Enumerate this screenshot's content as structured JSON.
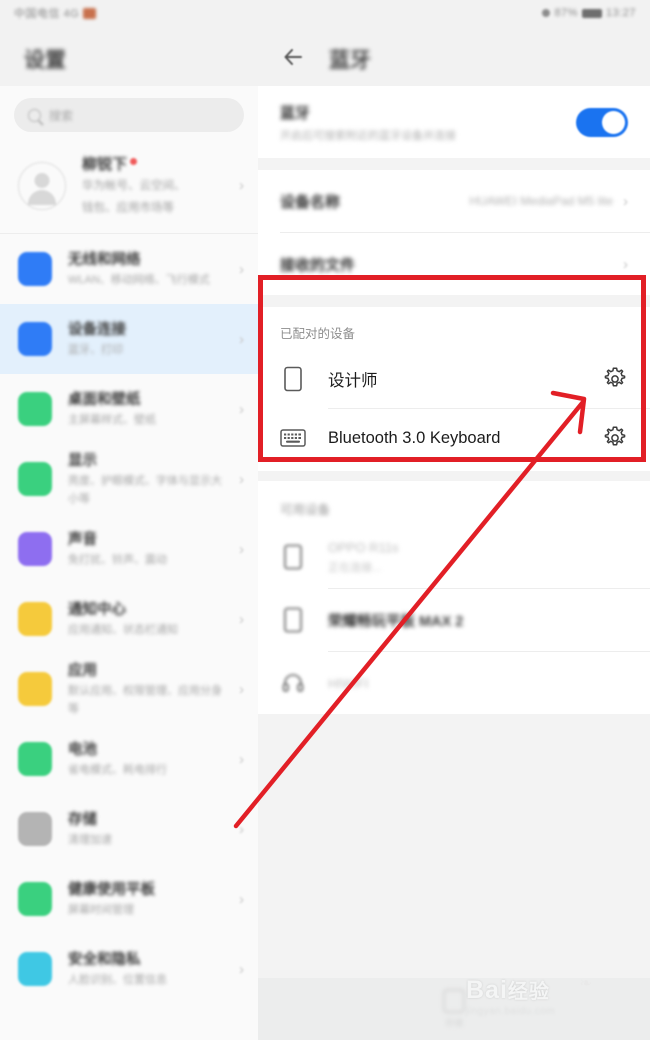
{
  "statusbar": {
    "left_text": "中国电信 4G",
    "right_text": "87%",
    "time": "13:27"
  },
  "sidebar": {
    "title": "设置",
    "search": {
      "placeholder": "搜索",
      "icon": "search-icon"
    },
    "account": {
      "name": "柳锐下",
      "badge": "•",
      "sub_line1": "华为帐号、云空间、",
      "sub_line2": "钱包、应用市场等",
      "chevron": "›"
    },
    "items": [
      {
        "title": "无线和网络",
        "sub": "WLAN、移动网络、飞行模式",
        "color": "#2f7cf6",
        "selected": false,
        "chevron": "›"
      },
      {
        "title": "设备连接",
        "sub": "蓝牙、打印",
        "color": "#2f7cf6",
        "selected": true,
        "chevron": "›"
      },
      {
        "title": "桌面和壁纸",
        "sub": "主屏幕样式、壁纸",
        "color": "#3ad07f",
        "selected": false,
        "chevron": "›"
      },
      {
        "title": "显示",
        "sub": "亮度、护眼模式、字体与显示大小等",
        "color": "#3ad07f",
        "selected": false,
        "chevron": "›"
      },
      {
        "title": "声音",
        "sub": "免打扰、铃声、震动",
        "color": "#8e6ef0",
        "selected": false,
        "chevron": "›"
      },
      {
        "title": "通知中心",
        "sub": "应用通知、状态栏通知",
        "color": "#f5ca3c",
        "selected": false,
        "chevron": "›"
      },
      {
        "title": "应用",
        "sub": "默认应用、权限管理、应用分身等",
        "color": "#f5ca3c",
        "selected": false,
        "chevron": "›"
      },
      {
        "title": "电池",
        "sub": "省电模式、耗电排行",
        "color": "#3ad07f",
        "selected": false,
        "chevron": "›"
      },
      {
        "title": "存储",
        "sub": "清理加速",
        "color": "#b4b4b4",
        "selected": false,
        "chevron": "›"
      },
      {
        "title": "健康使用平板",
        "sub": "屏幕时间管理",
        "color": "#3ad07f",
        "selected": false,
        "chevron": "›"
      },
      {
        "title": "安全和隐私",
        "sub": "人脸识别、位置信息",
        "color": "#3fc8e4",
        "selected": false,
        "chevron": "›"
      }
    ]
  },
  "header": {
    "back_icon": "back-arrow-icon",
    "title": "蓝牙"
  },
  "bluetooth": {
    "switch_label": "蓝牙",
    "switch_sub": "开启后可搜索附近的蓝牙设备并连接",
    "switch_on": true,
    "device_name_label": "设备名称",
    "device_name_value": "HUAWEI MediaPad M5 lite",
    "received_files_label": "接收的文件",
    "chevron": "›"
  },
  "paired": {
    "section_title": "已配对的设备",
    "devices": [
      {
        "name": "设计师",
        "icon": "phone-icon",
        "settings_icon": "gear-icon"
      },
      {
        "name": "Bluetooth 3.0 Keyboard",
        "icon": "keyboard-icon",
        "settings_icon": "gear-icon"
      }
    ]
  },
  "available": {
    "section_title": "可用设备",
    "devices": [
      {
        "name": "OPPO R11s",
        "sub": "正在连接...",
        "icon": "phone-icon",
        "strong": false
      },
      {
        "name": "荣耀畅玩平板 MAX 2",
        "sub": "",
        "icon": "phone-icon",
        "strong": true
      },
      {
        "name": "HIWIFI",
        "sub": "",
        "icon": "headset-icon",
        "strong": false
      }
    ]
  },
  "bottombar": {
    "item_label": "存储",
    "item_icon": "square-icon"
  },
  "annotation": {
    "highlight_color": "#e21f26",
    "arrow_color": "#e21f26",
    "arrow_from": "235,825",
    "arrow_to": "585,400",
    "target": "gear-icon of Bluetooth 3.0 Keyboard"
  },
  "watermark": {
    "main": "Bai",
    "suffix": "经验",
    "sub": "jingyan.baidu.com"
  }
}
